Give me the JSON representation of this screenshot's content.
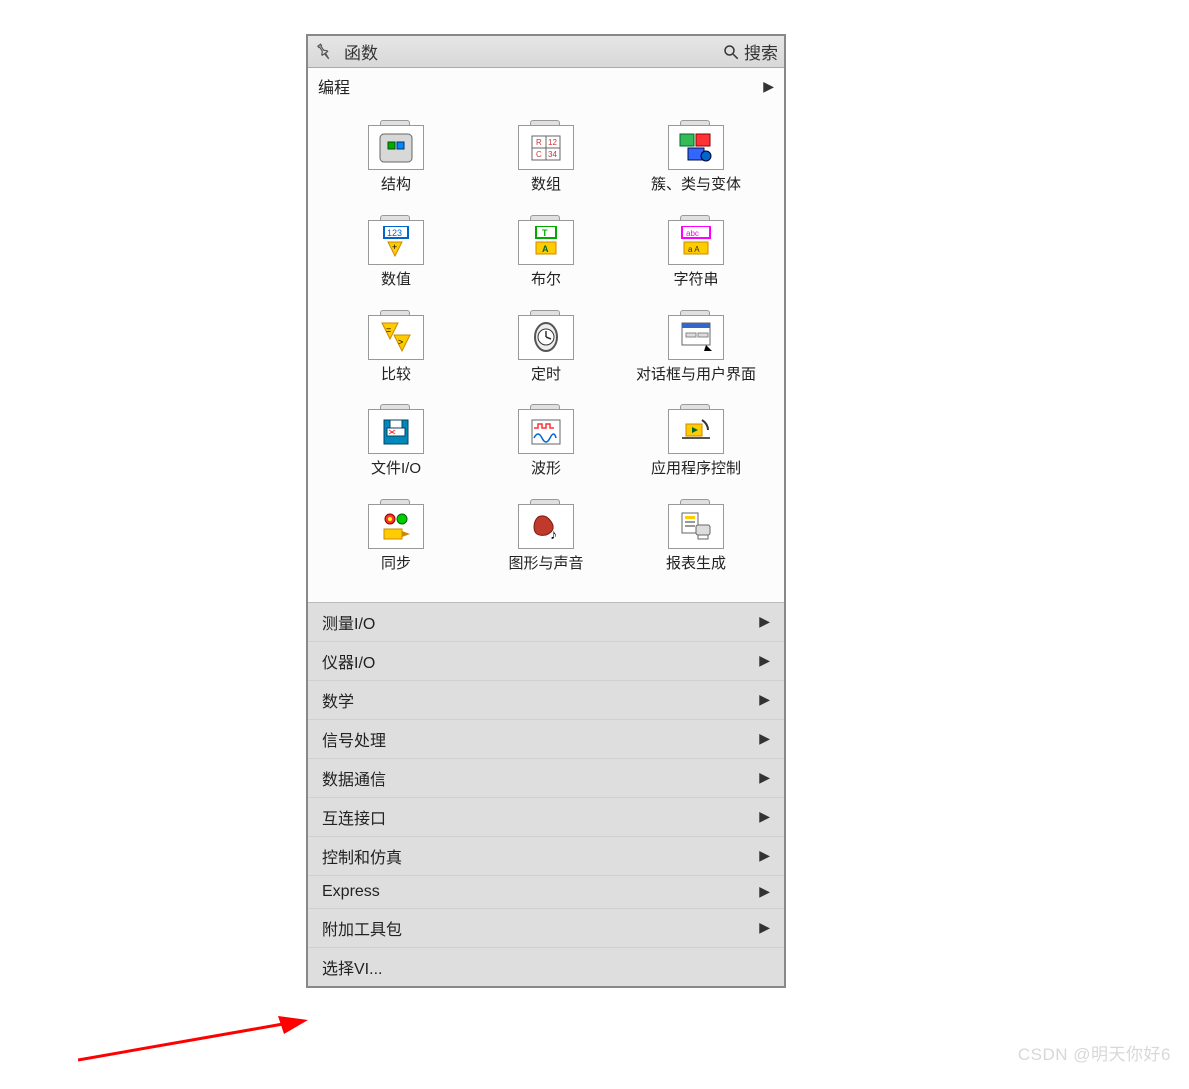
{
  "header": {
    "title": "函数",
    "search_label": "搜索"
  },
  "category": {
    "label": "编程"
  },
  "grid_items": [
    {
      "label": "结构",
      "icon": "structure"
    },
    {
      "label": "数组",
      "icon": "array"
    },
    {
      "label": "簇、类与变体",
      "icon": "cluster"
    },
    {
      "label": "数值",
      "icon": "numeric"
    },
    {
      "label": "布尔",
      "icon": "boolean"
    },
    {
      "label": "字符串",
      "icon": "string"
    },
    {
      "label": "比较",
      "icon": "compare"
    },
    {
      "label": "定时",
      "icon": "timing"
    },
    {
      "label": "对话框与用户界面",
      "icon": "dialog"
    },
    {
      "label": "文件I/O",
      "icon": "fileio"
    },
    {
      "label": "波形",
      "icon": "waveform"
    },
    {
      "label": "应用程序控制",
      "icon": "appctrl"
    },
    {
      "label": "同步",
      "icon": "sync"
    },
    {
      "label": "图形与声音",
      "icon": "graphics"
    },
    {
      "label": "报表生成",
      "icon": "report"
    }
  ],
  "menu_items": [
    "测量I/O",
    "仪器I/O",
    "数学",
    "信号处理",
    "数据通信",
    "互连接口",
    "控制和仿真",
    "Express",
    "附加工具包",
    "选择VI..."
  ],
  "watermark": "CSDN @明天你好6"
}
